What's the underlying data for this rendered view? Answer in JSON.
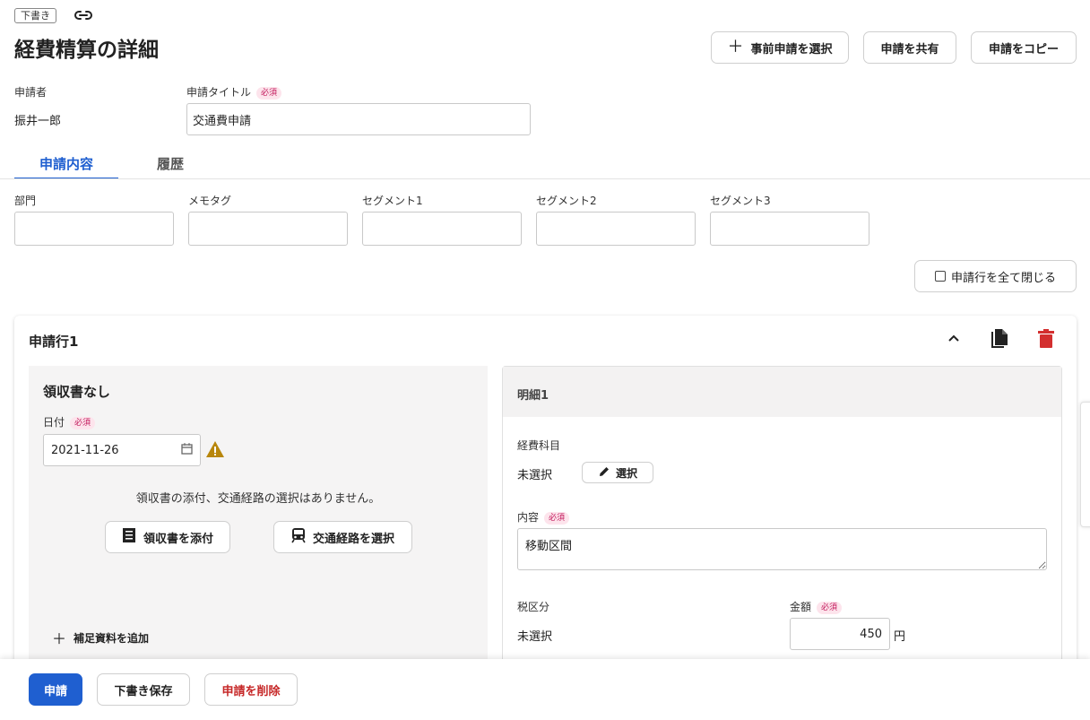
{
  "header": {
    "status_badge": "下書き",
    "title": "経費精算の詳細",
    "buttons": {
      "select_prior": "事前申請を選択",
      "share": "申請を共有",
      "copy": "申請をコピー"
    }
  },
  "applicant": {
    "label": "申請者",
    "value": "振井一郎"
  },
  "request_title": {
    "label": "申請タイトル",
    "required": "必須",
    "value": "交通費申請"
  },
  "tabs": [
    {
      "label": "申請内容",
      "active": true
    },
    {
      "label": "履歴",
      "active": false
    }
  ],
  "fields": [
    {
      "label": "部門",
      "value": ""
    },
    {
      "label": "メモタグ",
      "value": ""
    },
    {
      "label": "セグメント1",
      "value": ""
    },
    {
      "label": "セグメント2",
      "value": ""
    },
    {
      "label": "セグメント3",
      "value": ""
    }
  ],
  "collapse_all": "申請行を全て閉じる",
  "line": {
    "title": "申請行1",
    "receipt": {
      "heading": "領収書なし",
      "date_label": "日付",
      "date_required": "必須",
      "date_value": "2021-11-26",
      "message": "領収書の添付、交通経路の選択はありません。",
      "attach_button": "領収書を添付",
      "route_button": "交通経路を選択",
      "add_supplement": "補足資料を追加"
    },
    "detail": {
      "heading": "明細1",
      "account_label": "経費科目",
      "account_value": "未選択",
      "select_button": "選択",
      "content_label": "内容",
      "content_required": "必須",
      "content_value": "移動区間",
      "tax_label": "税区分",
      "tax_value": "未選択",
      "amount_label": "金額",
      "amount_required": "必須",
      "amount_value": "450",
      "amount_unit": "円"
    }
  },
  "footer": {
    "submit": "申請",
    "save_draft": "下書き保存",
    "delete": "申請を削除"
  },
  "colors": {
    "accent": "#1f5fd0",
    "danger": "#d32f2f",
    "warning": "#b8860b",
    "required_badge_bg": "#fde4ec"
  }
}
